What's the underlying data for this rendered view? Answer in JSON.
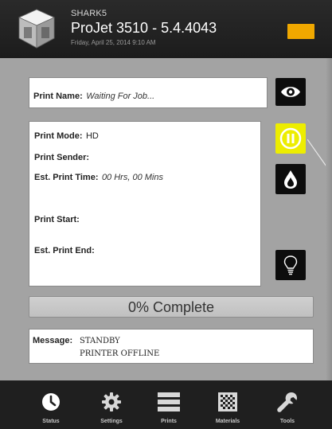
{
  "header": {
    "printer_name": "SHARK5",
    "model_version": "ProJet 3510 - 5.4.4043",
    "datetime": "Friday, April 25, 2014 9:10 AM",
    "status_color": "#f0a800"
  },
  "print_name": {
    "label": "Print Name:",
    "value": "Waiting For Job..."
  },
  "details": {
    "mode_label": "Print Mode:",
    "mode_value": "HD",
    "sender_label": "Print Sender:",
    "sender_value": "",
    "time_label": "Est. Print Time:",
    "time_value": "00 Hrs, 00 Mins",
    "start_label": "Print Start:",
    "start_value": "",
    "end_label": "Est. Print End:",
    "end_value": ""
  },
  "side_buttons": {
    "eye": "eye-icon",
    "pause": "pause-icon",
    "pause_color": "#eded00",
    "drop": "drop-icon",
    "bulb": "lightbulb-icon"
  },
  "progress": {
    "text": "0% Complete",
    "percent": 0
  },
  "message": {
    "label": "Message:",
    "line1": "STANDBY",
    "line2": "PRINTER OFFLINE"
  },
  "nav": [
    {
      "label": "Status",
      "icon": "clock-icon"
    },
    {
      "label": "Settings",
      "icon": "gear-icon"
    },
    {
      "label": "Prints",
      "icon": "list-icon"
    },
    {
      "label": "Materials",
      "icon": "checker-icon"
    },
    {
      "label": "Tools",
      "icon": "wrench-icon"
    }
  ]
}
